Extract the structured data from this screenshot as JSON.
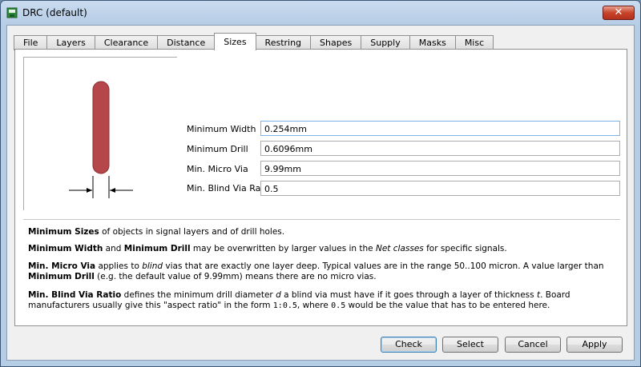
{
  "window": {
    "title": "DRC (default)",
    "close_glyph": "✕"
  },
  "tabs": [
    {
      "label": "File"
    },
    {
      "label": "Layers"
    },
    {
      "label": "Clearance"
    },
    {
      "label": "Distance"
    },
    {
      "label": "Sizes",
      "active": true
    },
    {
      "label": "Restring"
    },
    {
      "label": "Shapes"
    },
    {
      "label": "Supply"
    },
    {
      "label": "Masks"
    },
    {
      "label": "Misc"
    }
  ],
  "fields": {
    "min_width": {
      "label": "Minimum Width",
      "value": "0.254mm"
    },
    "min_drill": {
      "label": "Minimum Drill",
      "value": "0.6096mm"
    },
    "min_micro_via": {
      "label": "Min. Micro Via",
      "value": "9.99mm"
    },
    "min_blind_via_ratio": {
      "label": "Min. Blind Via Ratio",
      "value": "0.5"
    }
  },
  "help": {
    "p1_b1": "Minimum Sizes",
    "p1_t1": " of objects in signal layers and of drill holes.",
    "p2_b1": "Minimum Width",
    "p2_t1": " and ",
    "p2_b2": "Minimum Drill",
    "p2_t2": " may be overwritten by larger values in the ",
    "p2_i1": "Net classes",
    "p2_t3": " for specific signals.",
    "p3_b1": "Min. Micro Via",
    "p3_t1": " applies to ",
    "p3_i1": "blind",
    "p3_t2": " vias that are exactly one layer deep. Typical values are in the range 50..100 micron. A value larger than ",
    "p3_b2": "Minimum Drill",
    "p3_t3": " (e.g. the default value of 9.99mm) means there are no micro vias.",
    "p4_b1": "Min. Blind Via Ratio",
    "p4_t1": " defines the minimum drill diameter ",
    "p4_i1": "d",
    "p4_t2": " a blind via must have if it goes through a layer of thickness ",
    "p4_i2": "t",
    "p4_t3": ". Board manufacturers usually give this \"aspect ratio\" in the form ",
    "p4_c1": "1:0.5",
    "p4_t4": ", where ",
    "p4_c2": "0.5",
    "p4_t5": " would be the value that has to be entered here."
  },
  "buttons": {
    "check": "Check",
    "select": "Select",
    "cancel": "Cancel",
    "apply": "Apply"
  },
  "colors": {
    "wire": "#b5474a",
    "accent": "#3c7fb1"
  }
}
